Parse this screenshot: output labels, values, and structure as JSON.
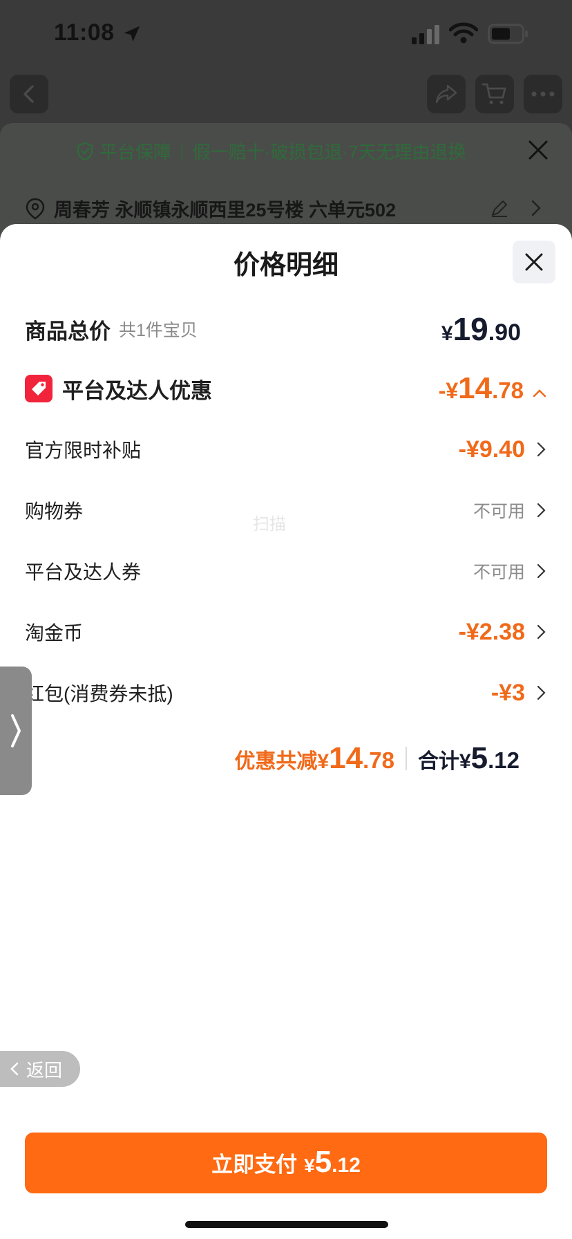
{
  "status_bar": {
    "time": "11:08"
  },
  "under_sheet": {
    "guarantee_title": "平台保障",
    "guarantee_detail": "假一赔十·破损包退·7天无理由退换",
    "address": "周春芳 永顺镇永顺西里25号楼 六单元502"
  },
  "sheet": {
    "title": "价格明细",
    "total": {
      "label": "商品总价",
      "sub": "共1件宝贝",
      "yen": "¥",
      "int": "19",
      "dec": ".90"
    },
    "discount": {
      "label": "平台及达人优惠",
      "prefix": "-¥",
      "int": "14",
      "dec": ".78"
    },
    "items": [
      {
        "label": "官方限时补贴",
        "value": "-¥9.40"
      },
      {
        "label": "购物券",
        "value": "不可用"
      },
      {
        "label": "平台及达人券",
        "value": "不可用"
      },
      {
        "label": "淘金币",
        "value": "-¥2.38"
      },
      {
        "label": "红包(消费券未抵)",
        "value": "-¥3"
      }
    ],
    "summary": {
      "saved_label": "优惠共减¥",
      "saved_int": "14",
      "saved_dec": ".78",
      "total_label": "合计¥",
      "total_int": "5",
      "total_dec": ".12"
    },
    "watermark": "扫描"
  },
  "back_pill": {
    "label": "返回"
  },
  "pay_button": {
    "label": "立即支付",
    "yen": "¥",
    "int": "5",
    "dec": ".12"
  },
  "colors": {
    "accent": "#ff6a12",
    "discount": "#f06a1a",
    "tag": "#f2243c",
    "guarantee": "#2f6b3a"
  }
}
